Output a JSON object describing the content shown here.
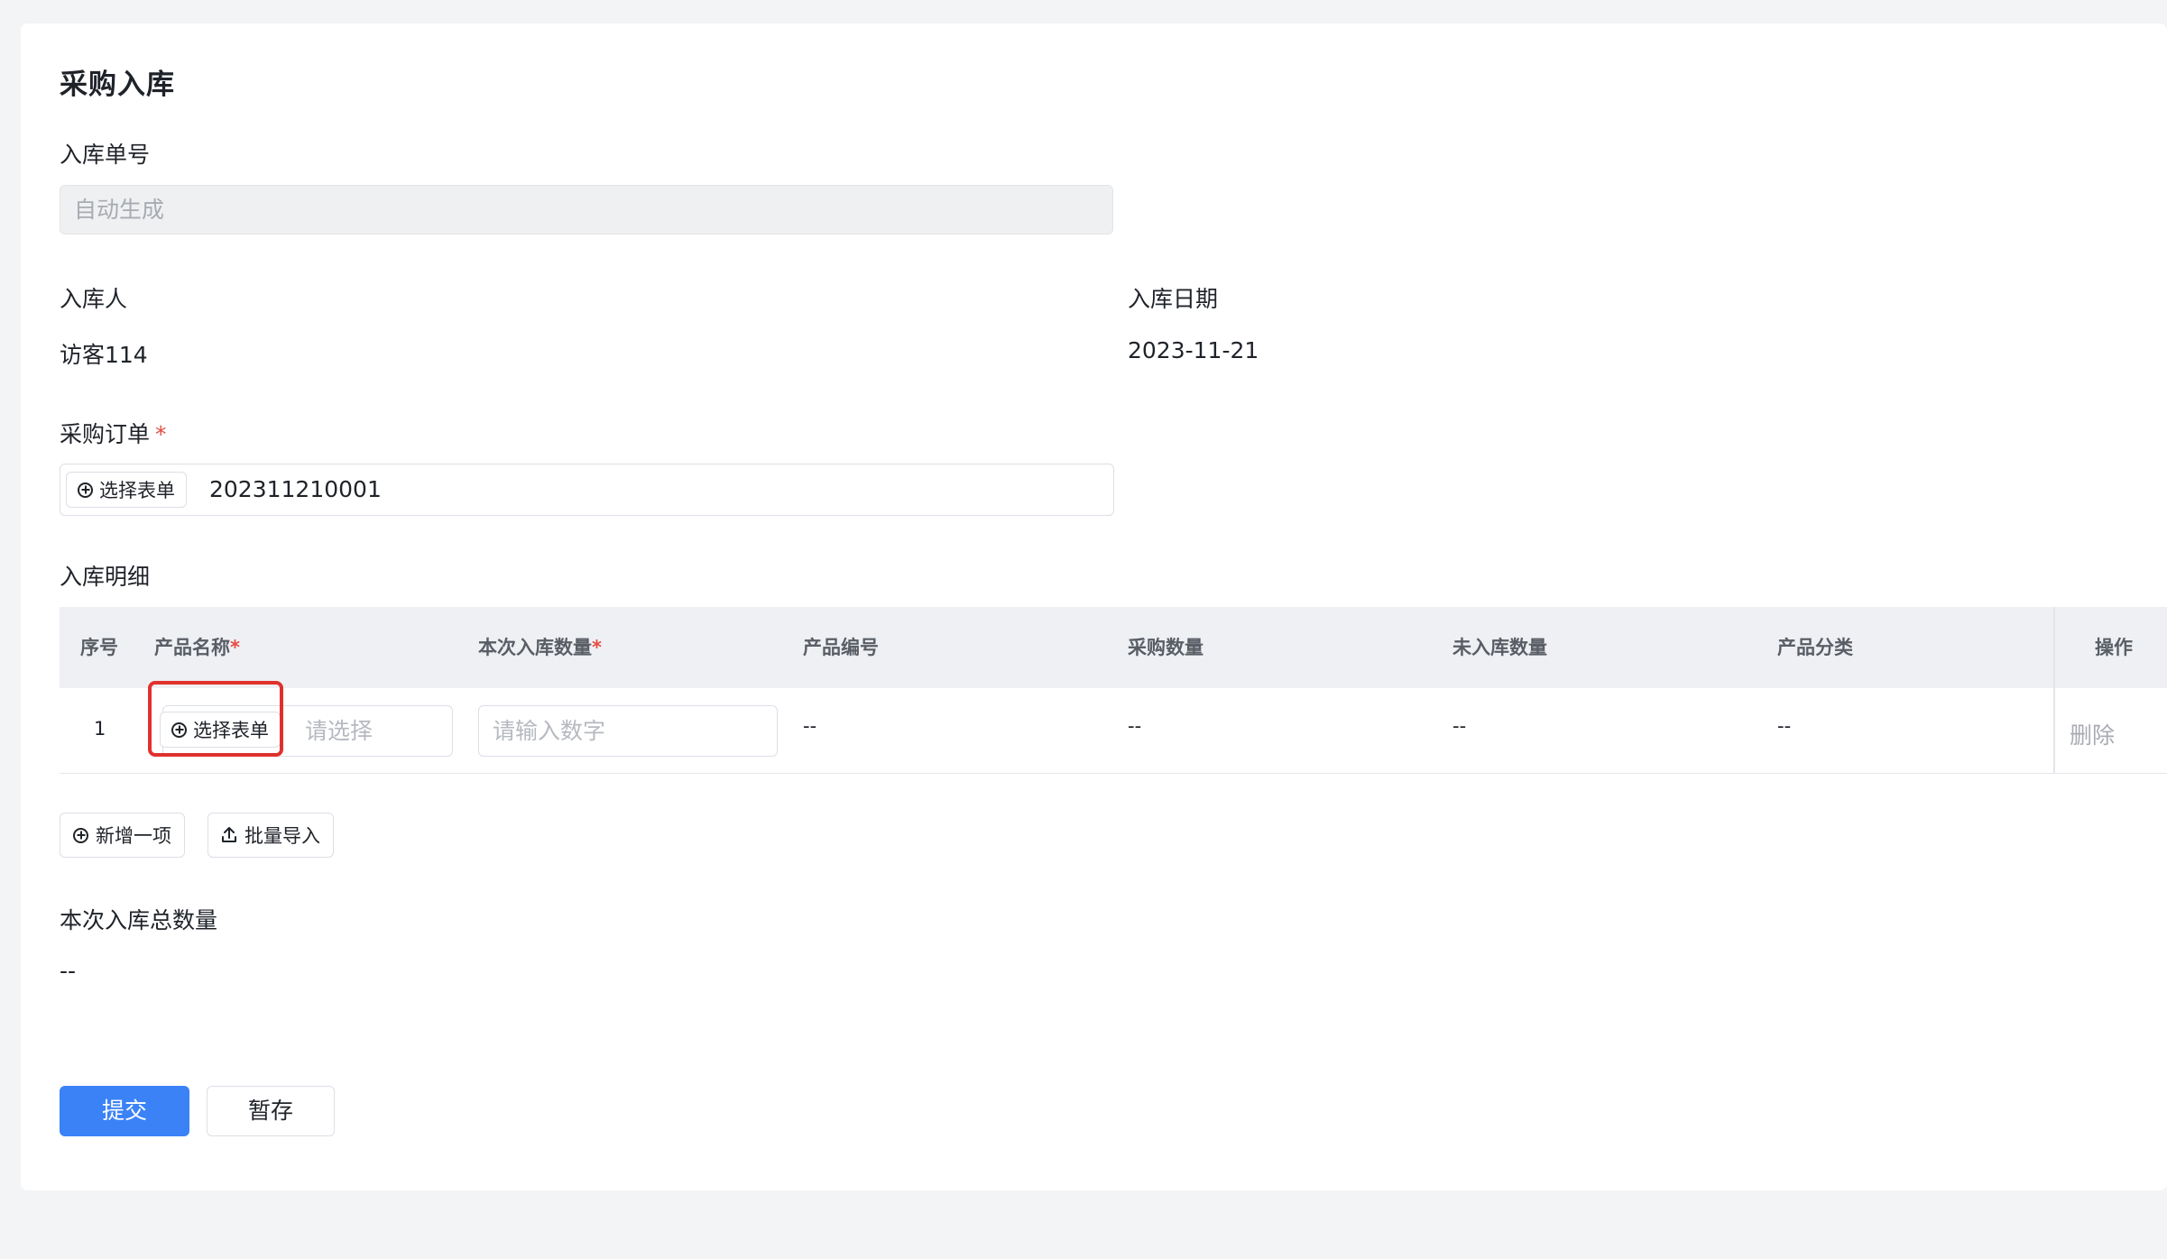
{
  "form": {
    "title": "采购入库",
    "order_no": {
      "label": "入库单号",
      "placeholder": "自动生成"
    },
    "operator": {
      "label": "入库人",
      "value": "访客114"
    },
    "date": {
      "label": "入库日期",
      "value": "2023-11-21"
    },
    "purchase_order": {
      "label": "采购订单",
      "required_mark": "*",
      "button_label": "选择表单",
      "value": "202311210001"
    },
    "details": {
      "label": "入库明细",
      "columns": [
        {
          "label": "序号",
          "required_mark": ""
        },
        {
          "label": "产品名称",
          "required_mark": "*"
        },
        {
          "label": "本次入库数量",
          "required_mark": "*"
        },
        {
          "label": "产品编号",
          "required_mark": ""
        },
        {
          "label": "采购数量",
          "required_mark": ""
        },
        {
          "label": "未入库数量",
          "required_mark": ""
        },
        {
          "label": "产品分类",
          "required_mark": ""
        },
        {
          "label": "操作",
          "required_mark": ""
        }
      ],
      "rows": [
        {
          "index": "1",
          "product_button_label": "选择表单",
          "product_placeholder": "请选择",
          "qty_placeholder": "请输入数字",
          "product_code": "--",
          "purchase_qty": "--",
          "pending_qty": "--",
          "category": "--",
          "action_label": "删除"
        }
      ],
      "add_button_label": "新增一项",
      "import_button_label": "批量导入"
    },
    "total": {
      "label": "本次入库总数量",
      "value": "--"
    },
    "submit_label": "提交",
    "save_label": "暂存"
  },
  "colors": {
    "primary": "#3b82f6",
    "required": "#e34d45",
    "highlight": "#e0312c",
    "page_background": "#f3f4f6"
  }
}
